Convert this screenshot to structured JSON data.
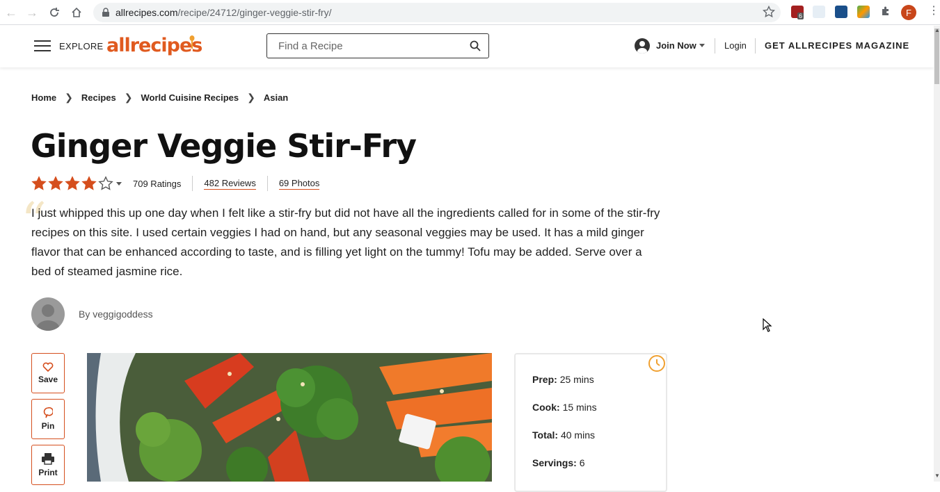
{
  "browser": {
    "url_host": "allrecipes.com",
    "url_path": "/recipe/24712/ginger-veggie-stir-fry/",
    "ext_badge": "6",
    "profile_initial": "F"
  },
  "header": {
    "explore_label": "EXPLORE",
    "logo_text": "allrecipes",
    "search_placeholder": "Find a Recipe",
    "join_label": "Join Now",
    "login_label": "Login",
    "magazine_label": "GET ALLRECIPES MAGAZINE"
  },
  "breadcrumb": [
    "Home",
    "Recipes",
    "World Cuisine Recipes",
    "Asian"
  ],
  "recipe": {
    "title": "Ginger Veggie Stir-Fry",
    "rating": 4,
    "ratings_count": "709 Ratings",
    "reviews": "482 Reviews",
    "photos": "69 Photos",
    "description": "I just whipped this up one day when I felt like a stir-fry but did not have all the ingredients called for in some of the stir-fry recipes on this site. I used certain veggies I had on hand, but any seasonal veggies may be used. It has a mild ginger flavor that can be enhanced according to taste, and is filling yet light on the tummy! Tofu may be added. Serve over a bed of steamed jasmine rice.",
    "author": "By veggigoddess"
  },
  "actions": {
    "save": "Save",
    "pin": "Pin",
    "print": "Print"
  },
  "times": {
    "prep_label": "Prep:",
    "prep_value": "25 mins",
    "cook_label": "Cook:",
    "cook_value": "15 mins",
    "total_label": "Total:",
    "total_value": "40 mins",
    "servings_label": "Servings:",
    "servings_value": "6"
  },
  "colors": {
    "brand": "#e05a1f",
    "star": "#d54e1d",
    "accent_border": "#d54e1d"
  }
}
